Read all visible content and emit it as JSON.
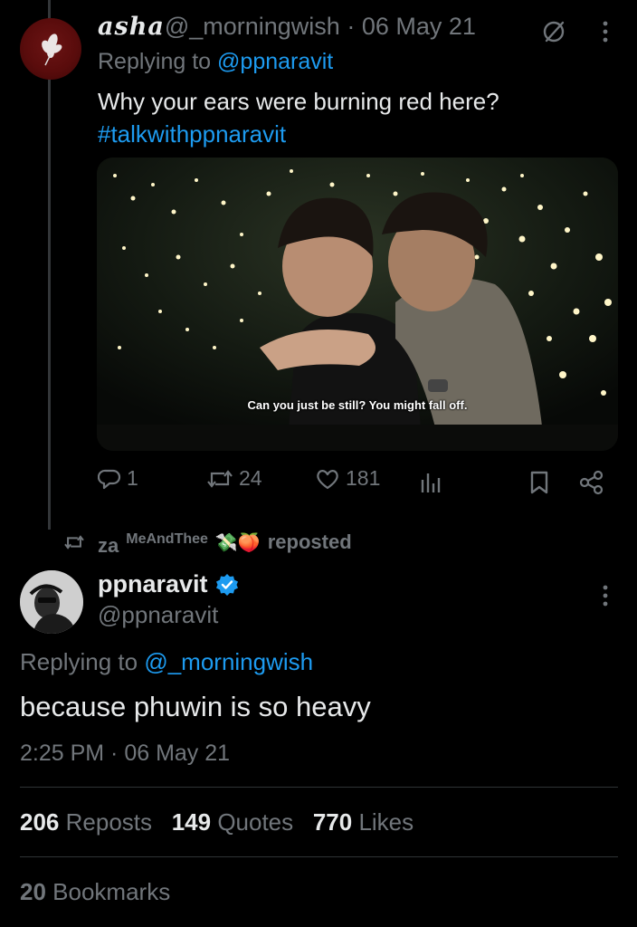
{
  "parent_tweet": {
    "display_name": "asha",
    "handle": "@_morningwish",
    "date": "· 06 May 21",
    "replying_prefix": "Replying to",
    "replying_to": "@ppnaravit",
    "text": "Why your ears were burning red here?",
    "hashtag": "#talkwithppnaravit",
    "media_subtitle": "Can you just be still? You might fall off.",
    "actions": {
      "replies": "1",
      "reposts": "24",
      "likes": "181"
    }
  },
  "repost_banner": {
    "prefix": "za",
    "name": "MeAndThee",
    "emojis": "💸🍑",
    "suffix": "reposted"
  },
  "main_tweet": {
    "display_name": "ppnaravit",
    "handle": "@ppnaravit",
    "replying_prefix": "Replying to",
    "replying_to": "@_morningwish",
    "text": "because phuwin is so heavy",
    "timestamp": "2:25 PM · 06 May 21",
    "stats": {
      "reposts_count": "206",
      "reposts_label": "Reposts",
      "quotes_count": "149",
      "quotes_label": "Quotes",
      "likes_count": "770",
      "likes_label": "Likes",
      "bookmarks_count": "20",
      "bookmarks_label": "Bookmarks"
    }
  },
  "colors": {
    "background": "#000000",
    "text": "#e7e9ea",
    "muted": "#71767b",
    "link": "#1d9bf0",
    "verified": "#1d9bf0"
  }
}
